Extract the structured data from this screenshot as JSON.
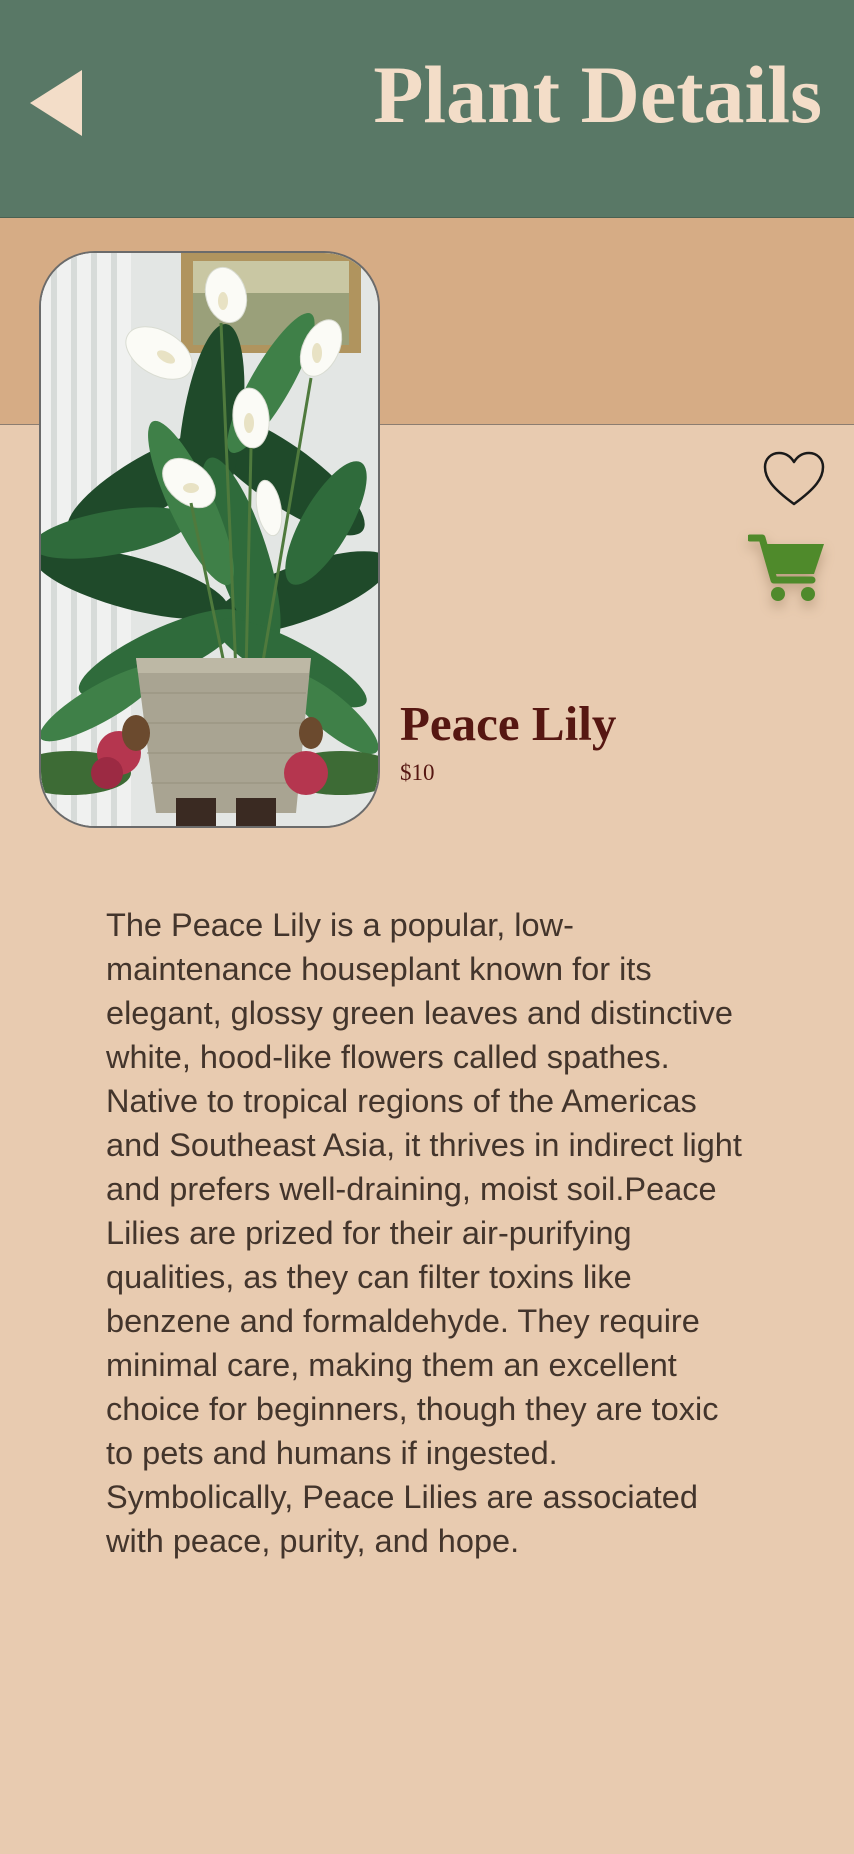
{
  "header": {
    "title": "Plant Details",
    "back_icon": "back-arrow-icon",
    "background_color": "#597866",
    "title_color": "#f3ddc8"
  },
  "plant": {
    "name": "Peace Lily",
    "price": "$10",
    "description": "The Peace Lily is a popular, low-maintenance houseplant known for its elegant, glossy green leaves and distinctive white, hood-like flowers called spathes. Native to tropical regions of the Americas and Southeast Asia, it thrives in indirect light and prefers well-draining, moist soil.Peace Lilies are prized for their air-purifying qualities, as they can filter toxins like benzene and formaldehyde. They require minimal care, making them an excellent choice for beginners, though they are toxic to pets and humans if ingested. Symbolically, Peace Lilies are associated with peace, purity, and hope."
  },
  "actions": {
    "favorite_icon": "heart-outline-icon",
    "cart_icon": "shopping-cart-icon",
    "cart_color": "#4f8a2b"
  },
  "colors": {
    "page_background": "#e8cbb0",
    "band_background": "#d6ac85",
    "name_color": "#561712",
    "text_color": "#43352c"
  }
}
